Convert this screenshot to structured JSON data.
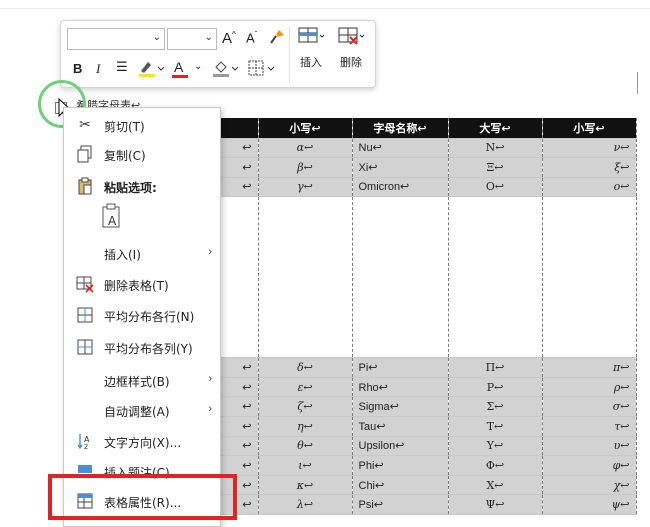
{
  "toolbar": {
    "font_name": "",
    "font_size": "",
    "grow_font": "A",
    "shrink_font": "A",
    "bold": "B",
    "italic": "I",
    "font_color_letter": "A",
    "insert_label": "插入",
    "delete_label": "删除"
  },
  "behind_text": "希腊字母表↩",
  "context_menu": {
    "items": [
      {
        "label": "剪切(T)",
        "icon": "scissors-icon"
      },
      {
        "label": "复制(C)",
        "icon": "copy-icon"
      },
      {
        "label": "粘贴选项:",
        "icon": "paste-icon"
      },
      {
        "label": "插入(I)",
        "icon": "",
        "submenu": true
      },
      {
        "label": "删除表格(T)",
        "icon": "delete-table-icon"
      },
      {
        "label": "平均分布各行(N)",
        "icon": "distribute-rows-icon"
      },
      {
        "label": "平均分布各列(Y)",
        "icon": "distribute-columns-icon"
      },
      {
        "label": "边框样式(B)",
        "icon": "",
        "submenu": true
      },
      {
        "label": "自动调整(A)",
        "icon": "",
        "submenu": true
      },
      {
        "label": "文字方向(X)...",
        "icon": "text-direction-icon"
      },
      {
        "label": "插入题注(C)...",
        "icon": "caption-icon"
      },
      {
        "label": "表格属性(R)...",
        "icon": "table-properties-icon"
      }
    ]
  },
  "table": {
    "headers": [
      "",
      "小写↩",
      "字母名称↩",
      "大写↩",
      "小写↩"
    ],
    "top_rows": [
      [
        "↩",
        "α↩",
        "Nu↩",
        "Ν↩",
        "ν↩"
      ],
      [
        "↩",
        "β↩",
        "Xi↩",
        "Ξ↩",
        "ξ↩"
      ],
      [
        "↩",
        "γ↩",
        "Omicron↩",
        "Ο↩",
        "ο↩"
      ]
    ],
    "bottom_rows": [
      [
        "↩",
        "δ↩",
        "Pi↩",
        "Π↩",
        "π↩"
      ],
      [
        "↩",
        "ε↩",
        "Rho↩",
        "Ρ↩",
        "ρ↩"
      ],
      [
        "↩",
        "ζ↩",
        "Sigma↩",
        "Σ↩",
        "σ↩"
      ],
      [
        "↩",
        "η↩",
        "Tau↩",
        "Τ↩",
        "τ↩"
      ],
      [
        "↩",
        "θ↩",
        "Upsilon↩",
        "Υ↩",
        "υ↩"
      ],
      [
        "↩",
        "ι↩",
        "Phi↩",
        "Φ↩",
        "φ↩"
      ],
      [
        "↩",
        "κ↩",
        "Chi↩",
        "Χ↩",
        "χ↩"
      ],
      [
        "↩",
        "λ↩",
        "Psi↩",
        "Ψ↩",
        "ψ↩"
      ]
    ]
  },
  "colors": {
    "header_bg": "#111111",
    "row_grey": "#d2d2d2",
    "highlight_red": "#e02424",
    "circle_green": "#6ed07a"
  }
}
